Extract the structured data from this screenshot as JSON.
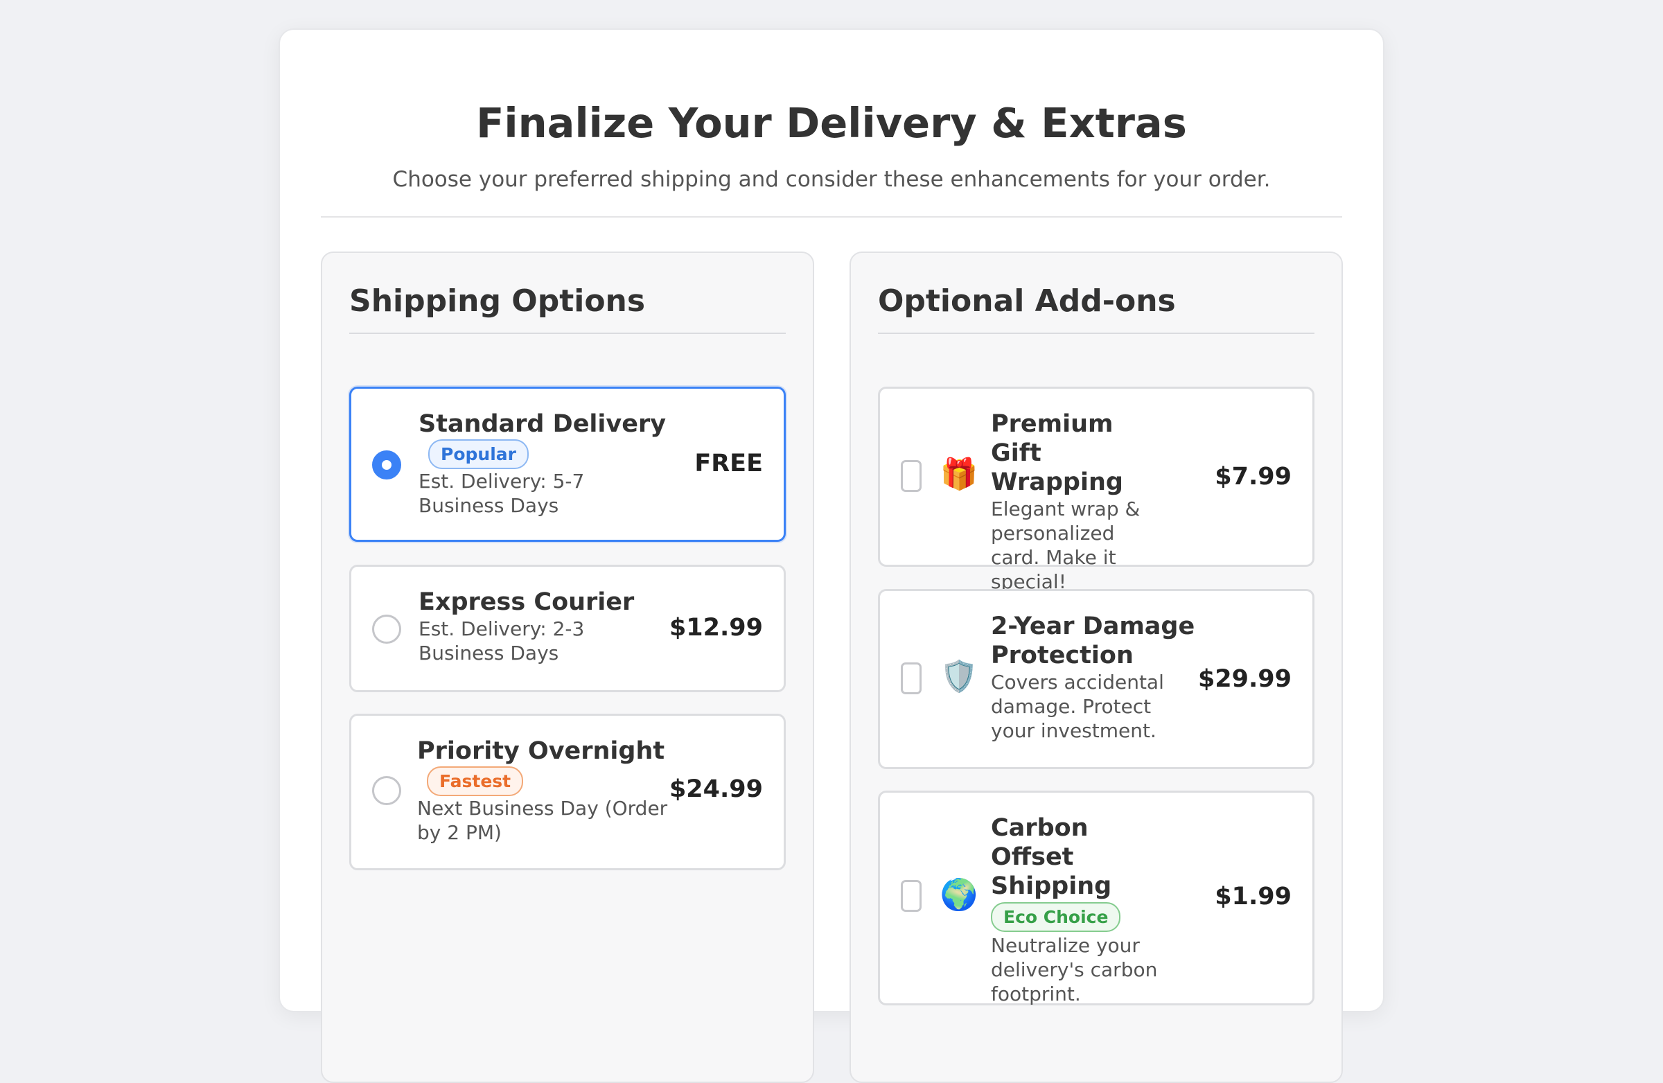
{
  "header": {
    "title": "Finalize Your Delivery & Extras",
    "subtitle": "Choose your preferred shipping and consider these enhancements for your order."
  },
  "shipping": {
    "title": "Shipping Options",
    "options": [
      {
        "name": "Standard Delivery",
        "badge": "Popular",
        "desc": "Est. Delivery: 5-7 Business Days",
        "price": "FREE",
        "selected": true
      },
      {
        "name": "Express Courier",
        "badge": "",
        "desc": "Est. Delivery: 2-3 Business Days",
        "price": "$12.99",
        "selected": false
      },
      {
        "name": "Priority Overnight",
        "badge": "Fastest",
        "desc": "Next Business Day (Order by 2 PM)",
        "price": "$24.99",
        "selected": false
      }
    ]
  },
  "addons": {
    "title": "Optional Add-ons",
    "items": [
      {
        "name": "Premium Gift Wrapping",
        "icon": "gift-icon",
        "desc": "Elegant wrap & personalized card. Make it special!",
        "price": "$7.99",
        "checked": false
      },
      {
        "name": "2-Year Damage Protection",
        "icon": "shield-icon",
        "desc": "Covers accidental damage. Protect your investment.",
        "price": "$29.99",
        "checked": false
      },
      {
        "name": "Carbon Offset Shipping",
        "badge": "Eco Choice",
        "icon": "globe-icon",
        "desc": "Neutralize your delivery's carbon footprint.",
        "price": "$1.99",
        "checked": false
      }
    ]
  },
  "colors": {
    "accent": "#3b82f6",
    "popular": "#2f74d9",
    "fastest": "#ea6d2a",
    "eco": "#36a048"
  }
}
